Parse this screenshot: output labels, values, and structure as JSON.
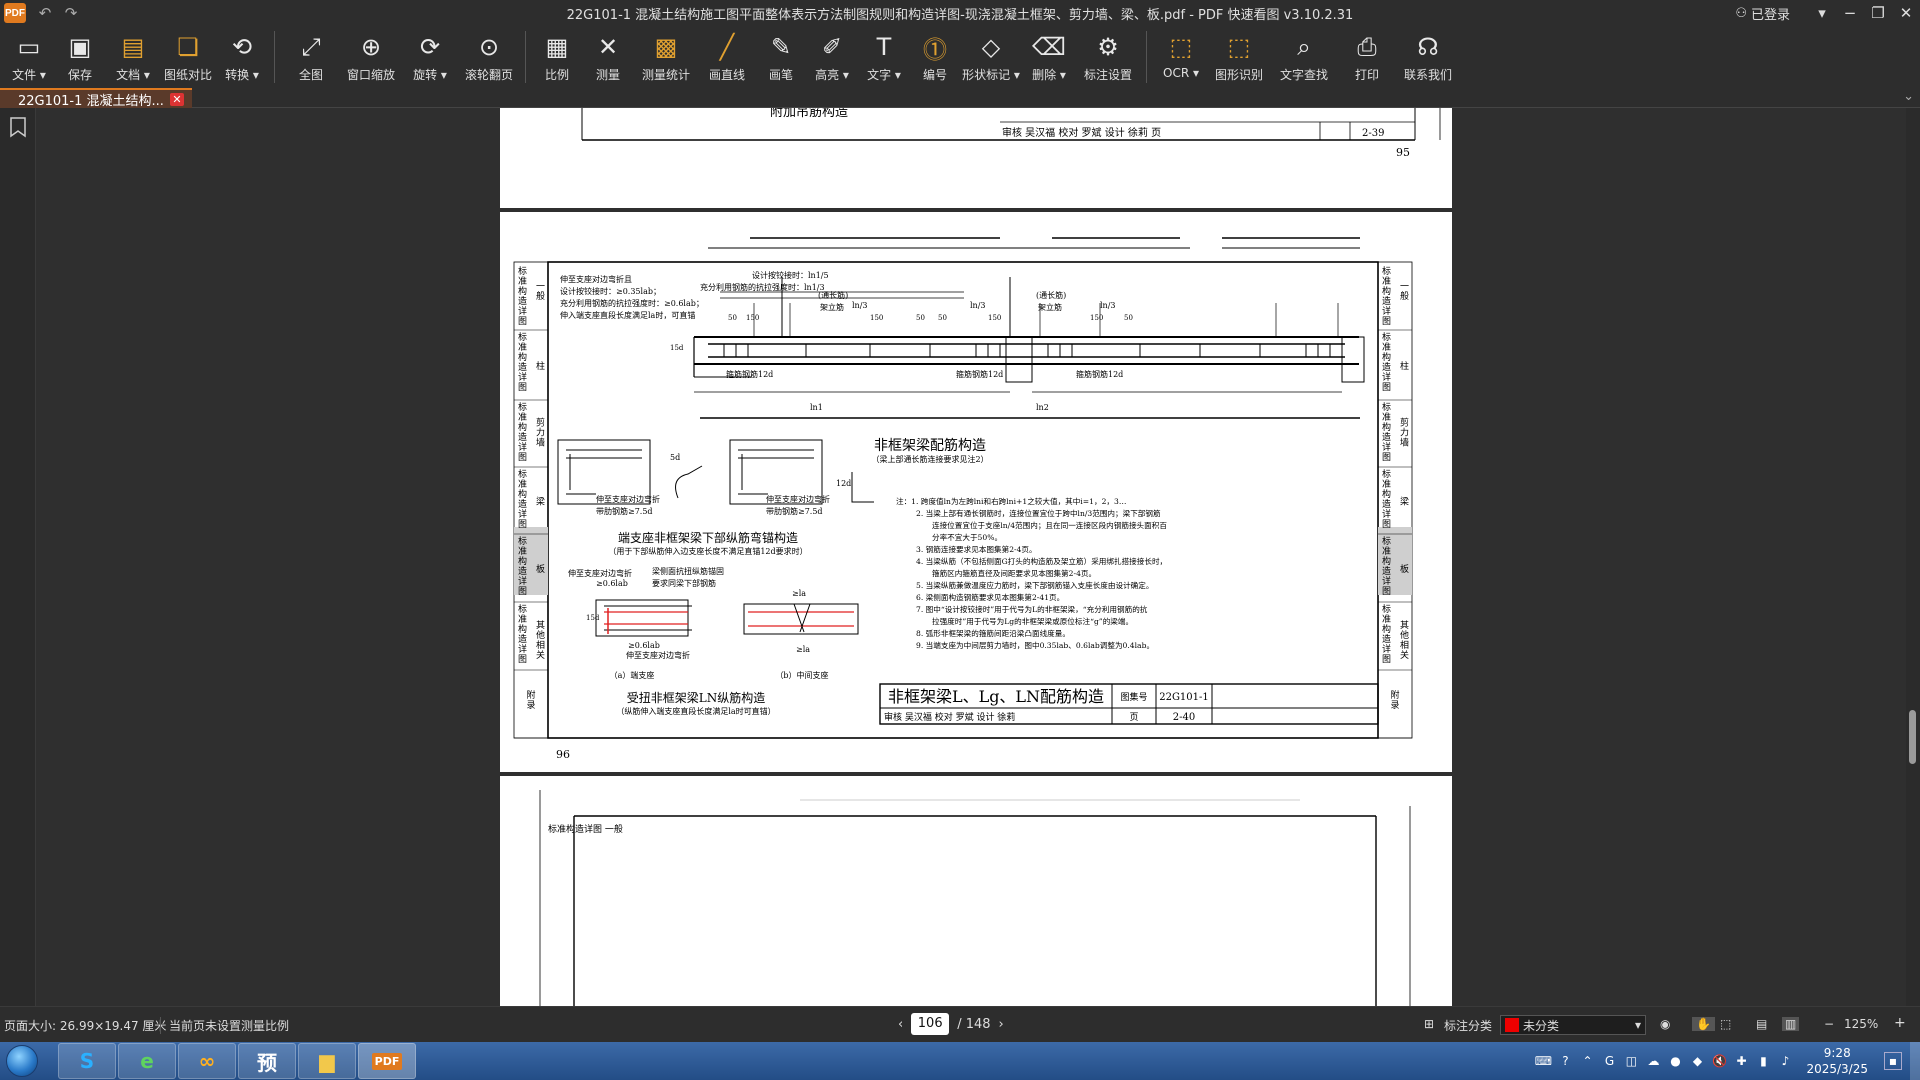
{
  "window": {
    "title": "22G101-1 混凝土结构施工图平面整体表示方法制图规则和构造详图-现浇混凝土框架、剪力墙、梁、板.pdf - PDF 快速看图 v3.10.2.31",
    "logo": "PDF",
    "login": "已登录"
  },
  "toolbar": {
    "tools": [
      {
        "label": "文件",
        "icon": "folder-icon"
      },
      {
        "label": "保存",
        "icon": "save-icon"
      },
      {
        "label": "文档",
        "icon": "document-icon"
      },
      {
        "label": "图纸对比",
        "icon": "compare-icon"
      },
      {
        "label": "转换",
        "icon": "convert-icon"
      },
      {
        "label": "全图",
        "icon": "fullview-icon"
      },
      {
        "label": "窗口缩放",
        "icon": "zoom-window-icon"
      },
      {
        "label": "旋转",
        "icon": "rotate-icon"
      },
      {
        "label": "滚轮翻页",
        "icon": "mousewheel-icon"
      },
      {
        "label": "比例",
        "icon": "scale-icon"
      },
      {
        "label": "测量",
        "icon": "measure-icon"
      },
      {
        "label": "测量统计",
        "icon": "measure-stats-icon"
      },
      {
        "label": "画直线",
        "icon": "line-icon"
      },
      {
        "label": "画笔",
        "icon": "pen-icon"
      },
      {
        "label": "高亮",
        "icon": "highlighter-icon"
      },
      {
        "label": "文字",
        "icon": "text-icon"
      },
      {
        "label": "编号",
        "icon": "number-icon"
      },
      {
        "label": "形状标记",
        "icon": "shape-mark-icon"
      },
      {
        "label": "删除",
        "icon": "eraser-icon"
      },
      {
        "label": "标注设置",
        "icon": "annotation-settings-icon"
      },
      {
        "label": "OCR",
        "icon": "ocr-icon"
      },
      {
        "label": "图形识别",
        "icon": "shape-recognition-icon"
      },
      {
        "label": "文字查找",
        "icon": "find-text-icon"
      },
      {
        "label": "打印",
        "icon": "print-icon"
      },
      {
        "label": "联系我们",
        "icon": "headset-icon"
      }
    ]
  },
  "tab": {
    "label": "22G101-1 混凝土结构..."
  },
  "pages": {
    "top": {
      "page_number": "95",
      "approval_row": "审核 吴汉福 校对 罗斌 设计 徐莉 页",
      "page_code": "2-39",
      "title_partial": "附加吊筋构造"
    },
    "main": {
      "sidebar": [
        "标准构造详图 一般",
        "标准构造详图 柱",
        "标准构造详图 剪力墙",
        "标准构造详图 梁",
        "标准构造详图 板",
        "标准构造详图 其他相关",
        "附录"
      ],
      "notes_top_left": [
        "伸至支座对边弯折且",
        "设计按铰接时：≥0.35lab；",
        "充分利用钢筋的抗拉强度时：≥0.6lab；",
        "伸入端支座直段长度满足la时，可直锚"
      ],
      "labels_top": [
        "设计按铰接时：ln1/5",
        "充分利用钢筋的抗拉强度时：ln1/3",
        "ln/3",
        "ln/3",
        "ln/3",
        "(通长筋)",
        "架立筋",
        "(通长筋)",
        "架立筋"
      ],
      "dims": [
        "50",
        "150",
        "150",
        "50",
        "50",
        "150",
        "150",
        "50",
        "15d",
        "ln1",
        "ln2"
      ],
      "stirrup_labels": [
        "箍筋钢筋12d",
        "箍筋钢筋12d",
        "箍筋钢筋12d"
      ],
      "main_caption": "非框架梁配筋构造",
      "main_subcaption": "（梁上部通长筋连接要求见注2）",
      "anchor_caption": "端支座非框架梁下部纵筋弯锚构造",
      "anchor_subcaption": "（用于下部纵筋伸入边支座长度不满足直锚12d要求时）",
      "anchor_labels": [
        "伸至支座对边弯折",
        "带肋钢筋≥7.5d",
        "伸至支座对边弯折",
        "带肋钢筋≥7.5d",
        "5d",
        "12d"
      ],
      "torsion_labels": [
        "伸至支座对边弯折",
        "≥0.6lab",
        "梁侧面抗扭纵筋锚固",
        "要求同梁下部钢筋",
        "≥0.6lab",
        "伸至支座对边弯折",
        "≥la",
        "≥la",
        "15d"
      ],
      "torsion_sub": [
        "（a）端支座",
        "（b）中间支座"
      ],
      "torsion_caption": "受扭非框架梁LN纵筋构造",
      "torsion_subcaption": "（纵筋伸入端支座直段长度满足la时可直锚）",
      "notes": [
        "注：1. 跨度值ln为左跨lni和右跨lni+1之较大值，其中i=1，2，3…",
        "2. 当梁上部有通长钢筋时，连接位置宜位于跨中ln/3范围内；梁下部钢筋",
        "连接位置宜位于支座ln/4范围内；且在同一连接区段内钢筋接头面积百",
        "分率不宜大于50%。",
        "3. 钢筋连接要求见本图集第2-4页。",
        "4. 当梁纵筋（不包括侧面G打头的构造筋及架立筋）采用绑扎搭接接长时，",
        "箍筋区内箍筋直径及间距要求见本图集第2-4页。",
        "5. 当梁纵筋兼做温度应力筋时，梁下部钢筋锚入支座长度由设计确定。",
        "6. 梁侧面构造钢筋要求见本图集第2-41页。",
        "7. 图中“设计按铰接时”用于代号为L的非框架梁，“充分利用钢筋的抗",
        "拉强度时”用于代号为Lg的非框架梁或原位标注“g”的梁端。",
        "8. 弧形非框架梁的箍筋间距沿梁凸面线度量。",
        "9. 当端支座为中间层剪力墙时，图中0.35lab、0.6lab调整为0.4lab。"
      ],
      "title_block": {
        "title": "非框架梁L、Lg、LN配筋构造",
        "set_label": "图集号",
        "set_code": "22G101-1",
        "approval_row": "审核 吴汉福 校对 罗斌 设计 徐莉",
        "page_label": "页",
        "page_code": "2-40"
      },
      "page_number": "96"
    },
    "bottom": {
      "sidebar_first": "标准构造详图 一般"
    }
  },
  "status": {
    "page_size": "页面大小: 26.99×19.47 厘米",
    "scale": "当前页未设置测量比例",
    "current_page": "106",
    "total_pages": "/ 148",
    "category_label": "标注分类",
    "category_value": "未分类",
    "zoom": "125%"
  },
  "taskbar": {
    "apps": [
      "browser-icon",
      "ie-icon",
      "cloud-icon",
      "预",
      "folder-icon",
      "PDF"
    ],
    "time": "9:28",
    "date": "2025/3/25"
  },
  "colors": {
    "accent": "#e07a1f",
    "red_line": "#e02020"
  }
}
